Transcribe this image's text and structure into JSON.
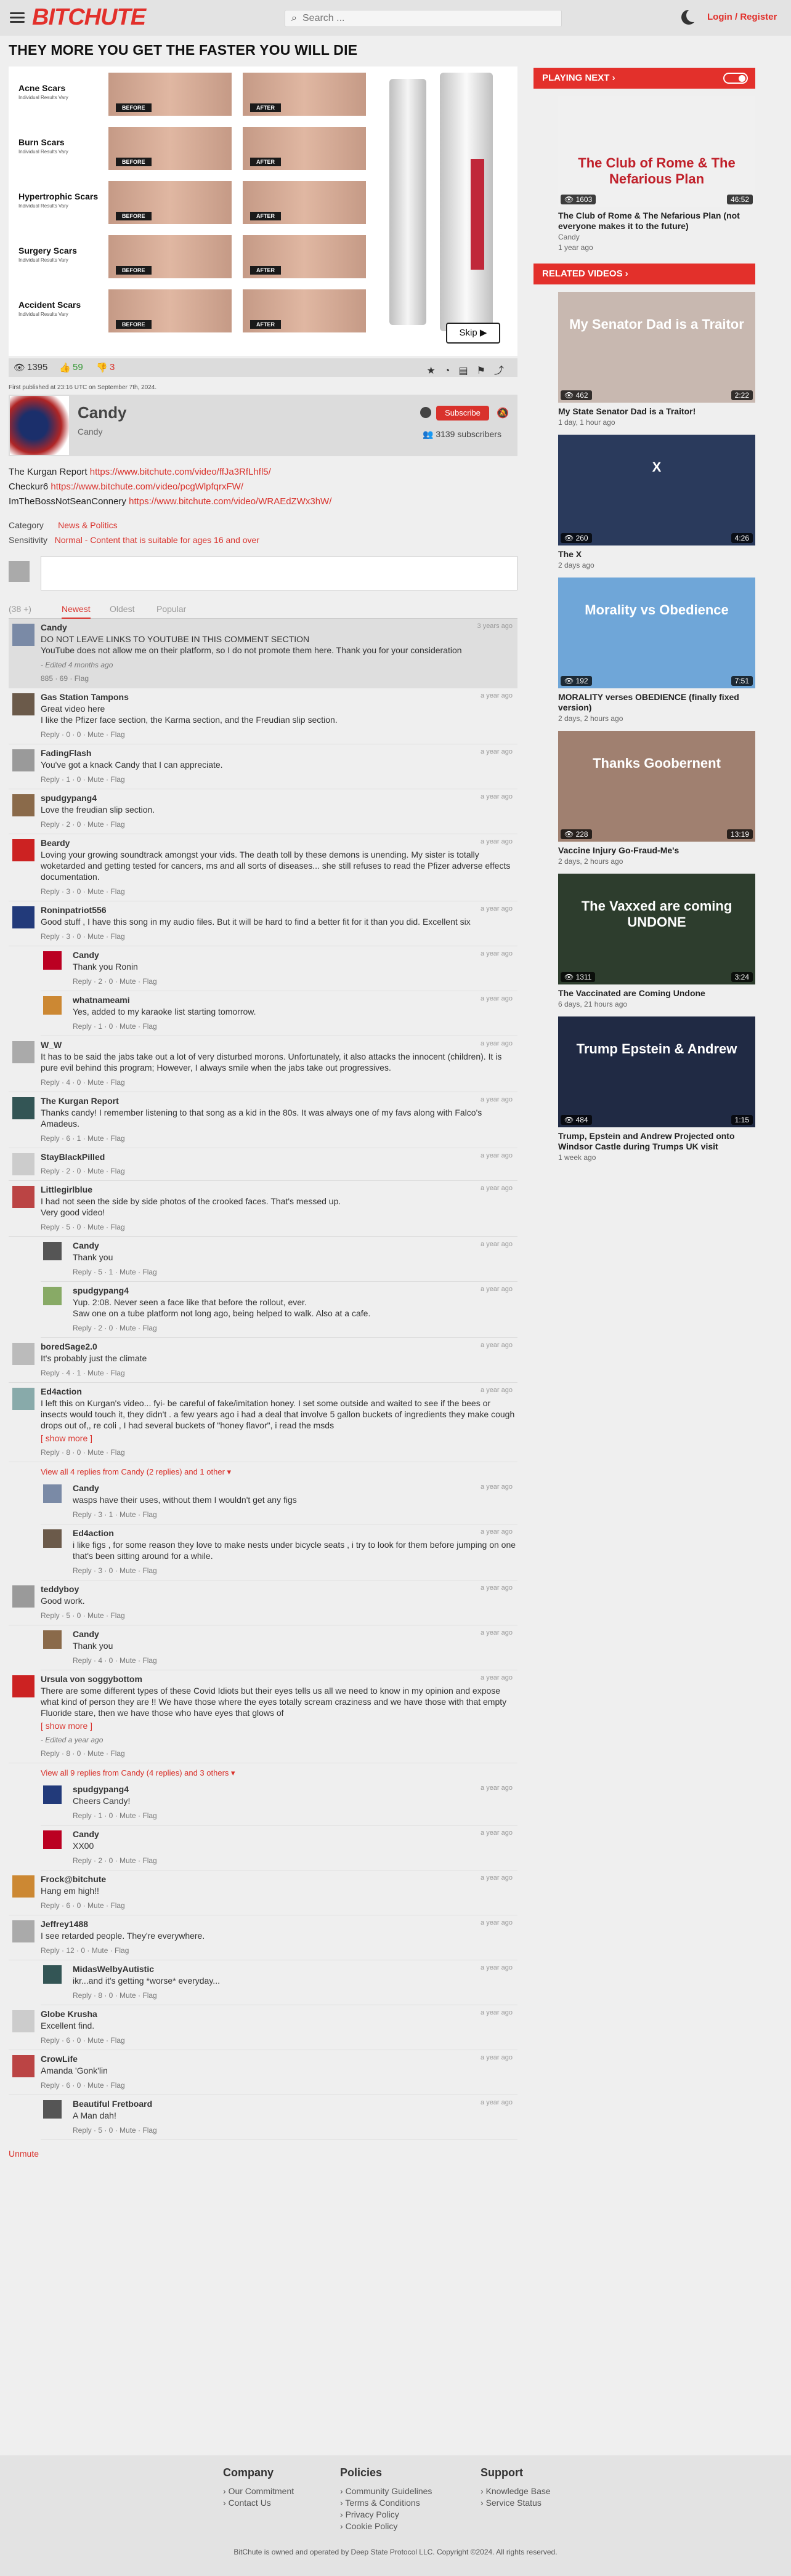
{
  "header": {
    "logo": "BITCHUTE",
    "search_placeholder": "Search ...",
    "search_icon": "search-icon",
    "login": "Login / Register"
  },
  "video": {
    "title": "THEY MORE YOU GET THE FASTER YOU WILL DIE",
    "ad": {
      "rows": [
        {
          "label": "Acne Scars",
          "sub": "Individual Results Vary"
        },
        {
          "label": "Burn Scars",
          "sub": "Individual Results Vary"
        },
        {
          "label": "Hypertrophic Scars",
          "sub": "Individual Results Vary"
        },
        {
          "label": "Surgery Scars",
          "sub": "Individual Results Vary"
        },
        {
          "label": "Accident Scars",
          "sub": "Individual Results Vary"
        }
      ],
      "before": "BEFORE",
      "after": "AFTER",
      "skip": "Skip ▶"
    },
    "views": "1395",
    "likes": "59",
    "dislikes": "3",
    "published": "First published at 23:16 UTC on September 7th, 2024."
  },
  "channel": {
    "name": "Candy",
    "sub": "Candy",
    "subscribe": "Subscribe",
    "subscribers": "3139 subscribers"
  },
  "description": [
    {
      "label": "The Kurgan Report ",
      "link": "https://www.bitchute.com/video/ffJa3RfLhfl5/"
    },
    {
      "label": "Checkur6 ",
      "link": "https://www.bitchute.com/video/pcgWlpfqrxFW/"
    },
    {
      "label": "ImTheBossNotSeanConnery ",
      "link": "https://www.bitchute.com/video/WRAEdZWx3hW/"
    }
  ],
  "meta": {
    "category_label": "Category",
    "category": "News & Politics",
    "sensitivity_label": "Sensitivity",
    "sensitivity": "Normal - Content that is suitable for ages 16 and over"
  },
  "comments_tabs": {
    "count": "(38 +)",
    "newest": "Newest",
    "oldest": "Oldest",
    "popular": "Popular"
  },
  "comments": [
    {
      "name": "Candy",
      "date": "3 years ago",
      "text": "DO NOT LEAVE LINKS TO YOUTUBE IN THIS COMMENT SECTION\nYouTube does not allow me on their platform, so I do not promote them here. Thank you for your consideration",
      "edited": "- Edited 4 months ago",
      "act": "885 · 69 · Flag",
      "pinned": true,
      "reply": false
    },
    {
      "name": "Gas Station Tampons",
      "date": "a year ago",
      "text": "Great video here\nI like the Pfizer face section, the Karma section, and the Freudian slip section.",
      "act": "Reply · 0 · 0 · Mute · Flag",
      "reply": false
    },
    {
      "name": "FadingFlash",
      "date": "a year ago",
      "text": "You've got a knack Candy that I can appreciate.",
      "act": "Reply · 1 · 0 · Mute · Flag",
      "reply": false
    },
    {
      "name": "spudgypang4",
      "date": "a year ago",
      "text": "Love the freudian slip section.",
      "act": "Reply · 2 · 0 · Mute · Flag",
      "reply": false
    },
    {
      "name": "Beardy",
      "date": "a year ago",
      "text": "Loving your growing soundtrack amongst your vids. The death toll by these demons is unending. My sister is totally woketarded and getting tested for cancers, ms and all sorts of diseases... she still refuses to read the Pfizer adverse effects documentation.",
      "act": "Reply · 3 · 0 · Mute · Flag",
      "reply": false
    },
    {
      "name": "Roninpatriot556",
      "date": "a year ago",
      "text": "Good stuff , I have this song in my audio files. But it will be hard to find a better fit for it than you did. Excellent six",
      "act": "Reply · 3 · 0 · Mute · Flag",
      "reply": false
    },
    {
      "name": "Candy",
      "date": "a year ago",
      "text": "Thank you Ronin",
      "act": "Reply · 2 · 0 · Mute · Flag",
      "reply": true
    },
    {
      "name": "whatnameami",
      "date": "a year ago",
      "text": "Yes, added to my karaoke list starting tomorrow.",
      "act": "Reply · 1 · 0 · Mute · Flag",
      "reply": true
    },
    {
      "name": "W_W",
      "date": "a year ago",
      "text": "It has to be said the jabs take out a lot of very disturbed morons. Unfortunately, it also attacks the innocent (children). It is pure evil behind this program; However, I always smile when the jabs take out progressives.",
      "act": "Reply · 4 · 0 · Mute · Flag",
      "reply": false
    },
    {
      "name": "The Kurgan Report",
      "date": "a year ago",
      "text": "Thanks candy! I remember listening to that song as a kid in the 80s. It was always one of my favs along with Falco's Amadeus.",
      "act": "Reply · 6 · 1 · Mute · Flag",
      "reply": false
    },
    {
      "name": "StayBlackPilled",
      "date": "a year ago",
      "text": "",
      "act": "Reply · 2 · 0 · Mute · Flag",
      "reply": false
    },
    {
      "name": "Littlegirlblue",
      "date": "a year ago",
      "text": "I had not seen the side by side photos of the crooked faces. That's messed up.\nVery good video!",
      "act": "Reply · 5 · 0 · Mute · Flag",
      "reply": false
    },
    {
      "name": "Candy",
      "date": "a year ago",
      "text": "Thank you",
      "act": "Reply · 5 · 1 · Mute · Flag",
      "reply": true
    },
    {
      "name": "spudgypang4",
      "date": "a year ago",
      "text": "Yup. 2:08. Never seen a face like that before the rollout, ever.\nSaw one on a tube platform not long ago, being helped to walk. Also at a cafe.",
      "act": "Reply · 2 · 0 · Mute · Flag",
      "reply": true
    },
    {
      "name": "boredSage2.0",
      "date": "a year ago",
      "text": "It's probably just the climate",
      "act": "Reply · 4 · 1 · Mute · Flag",
      "reply": false
    },
    {
      "name": "Ed4action",
      "date": "a year ago",
      "text": "I left this on Kurgan's video... fyi- be careful of fake/imitation honey. I set some outside and waited to see if the bees or insects would touch it, they didn't . a few years ago i had a deal that involve 5 gallon buckets of ingredients they make cough drops out of,, re coli , I had several buckets of \"honey flavor\", i read the msds",
      "more": "[ show more ]",
      "act": "Reply · 8 · 0 · Mute · Flag",
      "reply": false
    },
    {
      "name": "Candy",
      "date": "a year ago",
      "text": "wasps have their uses, without them I wouldn't get any figs",
      "act": "Reply · 3 · 1 · Mute · Flag",
      "reply": true
    },
    {
      "name": "Ed4action",
      "date": "a year ago",
      "text": "i like figs , for some reason they love to make nests under bicycle seats , i try to look for them before jumping on one that's been sitting around for a while.",
      "act": "Reply · 3 · 0 · Mute · Flag",
      "reply": true
    },
    {
      "name": "teddyboy",
      "date": "a year ago",
      "text": "Good work.",
      "act": "Reply · 5 · 0 · Mute · Flag",
      "reply": false
    },
    {
      "name": "Candy",
      "date": "a year ago",
      "text": "Thank you",
      "act": "Reply · 4 · 0 · Mute · Flag",
      "reply": true
    },
    {
      "name": "Ursula von soggybottom",
      "date": "a year ago",
      "text": "There are some different types of these Covid Idiots but their eyes tells us all we need to know in my opinion and expose what kind of person they are !! We have those where the eyes totally scream craziness and we have those with that empty Fluoride stare, then we have those who have eyes that glows of",
      "more": "[ show more ]",
      "edited": "- Edited a year ago",
      "act": "Reply · 8 · 0 · Mute · Flag",
      "reply": false
    },
    {
      "name": "spudgypang4",
      "date": "a year ago",
      "text": "Cheers Candy!",
      "act": "Reply · 1 · 0 · Mute · Flag",
      "reply": true
    },
    {
      "name": "Candy",
      "date": "a year ago",
      "text": "XX00",
      "act": "Reply · 2 · 0 · Mute · Flag",
      "reply": true
    },
    {
      "name": "Frock@bitchute",
      "date": "a year ago",
      "text": "Hang em high!!",
      "act": "Reply · 6 · 0 · Mute · Flag",
      "reply": false
    },
    {
      "name": "Jeffrey1488",
      "date": "a year ago",
      "text": "I see retarded people. They're everywhere.",
      "act": "Reply · 12 · 0 · Mute · Flag",
      "reply": false
    },
    {
      "name": "MidasWelbyAutistic",
      "date": "a year ago",
      "text": "ikr...and it's getting *worse* everyday...",
      "act": "Reply · 8 · 0 · Mute · Flag",
      "reply": true
    },
    {
      "name": "Globe Krusha",
      "date": "a year ago",
      "text": "Excellent find.",
      "act": "Reply · 6 · 0 · Mute · Flag",
      "reply": false
    },
    {
      "name": "CrowLife",
      "date": "a year ago",
      "text": "Amanda 'Gonk'lin",
      "act": "Reply · 6 · 0 · Mute · Flag",
      "reply": false
    },
    {
      "name": "Beautiful Fretboard",
      "date": "a year ago",
      "text": "A Man dah!",
      "act": "Reply · 5 · 0 · Mute · Flag",
      "reply": true
    }
  ],
  "viewall1": "View all 4 replies from Candy (2 replies) and 1 other ▾",
  "viewall2": "View all 9 replies from Candy (4 replies) and 3 others ▾",
  "unmute": "Unmute",
  "sidebar": {
    "playing_next": "PLAYING NEXT",
    "related": "RELATED VIDEOS",
    "next": {
      "thumb_text": "The Club of Rome & The Nefarious Plan",
      "views": "1603",
      "dur": "46:52",
      "title": "The Club of Rome & The Nefarious Plan (not everyone makes it to the future)",
      "channel": "Candy",
      "age": "1 year ago"
    },
    "videos": [
      {
        "thumb_text": "My Senator Dad is a Traitor",
        "views": "462",
        "dur": "2:22",
        "title": "My State Senator Dad is a Traitor!",
        "age": "1 day, 1 hour ago",
        "bg": "#c8b8b0"
      },
      {
        "thumb_text": "X",
        "views": "260",
        "dur": "4:26",
        "title": "The X",
        "age": "2 days ago",
        "bg": "#2a3a5c"
      },
      {
        "thumb_text": "Morality vs Obedience",
        "views": "192",
        "dur": "7:51",
        "title": "MORALITY verses OBEDIENCE (finally fixed version)",
        "age": "2 days, 2 hours ago",
        "bg": "#6fa6d8"
      },
      {
        "thumb_text": "Thanks Goobernent",
        "views": "228",
        "dur": "13:19",
        "title": "Vaccine Injury Go-Fraud-Me's",
        "age": "2 days, 2 hours ago",
        "bg": "#a08070"
      },
      {
        "thumb_text": "The Vaxxed are coming UNDONE",
        "views": "1311",
        "dur": "3:24",
        "title": "The Vaccinated are Coming Undone",
        "age": "6 days, 21 hours ago",
        "bg": "#2d3d2d"
      },
      {
        "thumb_text": "Trump Epstein & Andrew",
        "views": "484",
        "dur": "1:15",
        "title": "Trump, Epstein and Andrew Projected onto Windsor Castle during Trumps UK visit",
        "age": "1 week ago",
        "bg": "#202a44"
      }
    ]
  },
  "footer": {
    "company": "Company",
    "company_links": [
      "Our Commitment",
      "Contact Us"
    ],
    "policies": "Policies",
    "policies_links": [
      "Community Guidelines",
      "Terms & Conditions",
      "Privacy Policy",
      "Cookie Policy"
    ],
    "support": "Support",
    "support_links": [
      "Knowledge Base",
      "Service Status"
    ],
    "copyright": "BitChute is owned and operated by Deep State Protocol LLC. Copyright ©2024. All rights reserved."
  }
}
